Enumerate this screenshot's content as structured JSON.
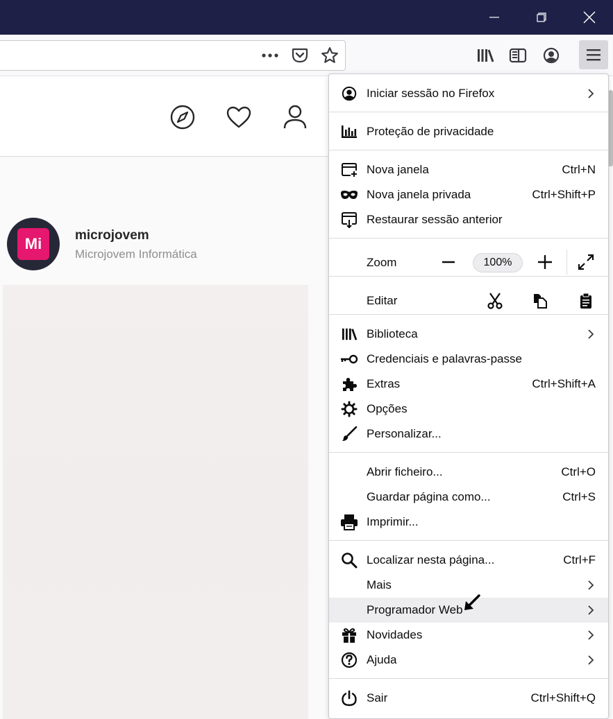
{
  "window": {
    "controls": [
      "minimize-icon",
      "restore-icon",
      "close-icon"
    ],
    "titlebar_color": "#1f2047"
  },
  "toolbar": {
    "url_actions": [
      "more-dots-icon",
      "pocket-icon",
      "star-icon"
    ],
    "right_icons": [
      "library-icon",
      "sidebar-icon",
      "account-icon",
      "hamburger-menu-icon"
    ]
  },
  "page": {
    "header_icons": [
      "compass-icon",
      "heart-icon",
      "person-icon"
    ],
    "profile": {
      "avatar_text": "Mi",
      "username": "microjovem",
      "fullname": "Microjovem Informática"
    },
    "accent_color": "#e5176e"
  },
  "menu": {
    "signin": {
      "label": "Iniciar sessão no Firefox",
      "icon": "account-icon"
    },
    "privacy": {
      "label": "Proteção de privacidade",
      "icon": "privacy-chart-icon"
    },
    "new_window": {
      "label": "Nova janela",
      "shortcut": "Ctrl+N",
      "icon": "new-window-icon"
    },
    "private_window": {
      "label": "Nova janela privada",
      "shortcut": "Ctrl+Shift+P",
      "icon": "private-mask-icon"
    },
    "restore_session": {
      "label": "Restaurar sessão anterior",
      "icon": "restore-session-icon"
    },
    "zoom": {
      "label": "Zoom",
      "value": "100%"
    },
    "edit": {
      "label": "Editar",
      "actions": [
        "cut-icon",
        "copy-icon",
        "paste-icon"
      ]
    },
    "library": {
      "label": "Biblioteca",
      "icon": "library-icon"
    },
    "logins": {
      "label": "Credenciais e palavras-passe",
      "icon": "key-icon"
    },
    "addons": {
      "label": "Extras",
      "shortcut": "Ctrl+Shift+A",
      "icon": "puzzle-icon"
    },
    "options": {
      "label": "Opções",
      "icon": "gear-icon"
    },
    "customize": {
      "label": "Personalizar...",
      "icon": "brush-icon"
    },
    "open_file": {
      "label": "Abrir ficheiro...",
      "shortcut": "Ctrl+O"
    },
    "save_page": {
      "label": "Guardar página como...",
      "shortcut": "Ctrl+S"
    },
    "print": {
      "label": "Imprimir...",
      "icon": "printer-icon"
    },
    "find": {
      "label": "Localizar nesta página...",
      "shortcut": "Ctrl+F",
      "icon": "search-icon"
    },
    "more": {
      "label": "Mais"
    },
    "web_developer": {
      "label": "Programador Web"
    },
    "whats_new": {
      "label": "Novidades",
      "icon": "gift-icon"
    },
    "help": {
      "label": "Ajuda",
      "icon": "help-icon"
    },
    "quit": {
      "label": "Sair",
      "shortcut": "Ctrl+Shift+Q",
      "icon": "power-icon"
    }
  }
}
